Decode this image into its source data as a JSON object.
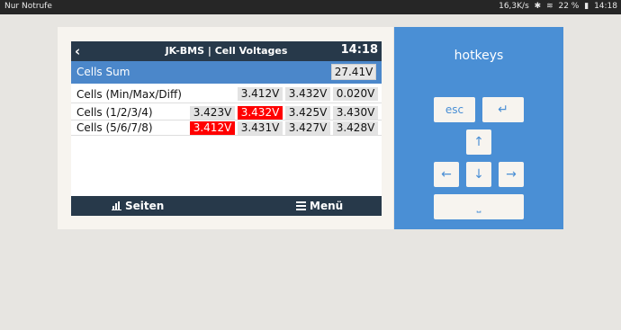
{
  "statusbar": {
    "carrier": "Nur Notrufe",
    "net_speed": "16,3K/s",
    "battery": "22 %",
    "time": "14:18"
  },
  "header": {
    "title": "JK-BMS | Cell Voltages",
    "clock": "14:18"
  },
  "sum": {
    "label": "Cells Sum",
    "value": "27.41V"
  },
  "rows": [
    {
      "label": "Cells (Min/Max/Diff)",
      "values": [
        "3.412V",
        "3.432V",
        "0.020V"
      ]
    },
    {
      "label": "Cells (1/2/3/4)",
      "values": [
        "3.423V",
        "3.432V",
        "3.425V",
        "3.430V"
      ]
    },
    {
      "label": "Cells (5/6/7/8)",
      "values": [
        "3.412V",
        "3.431V",
        "3.427V",
        "3.428V"
      ]
    }
  ],
  "footer": {
    "pages_label": "Seiten",
    "menu_label": "Menü"
  },
  "hotkeys": {
    "title": "hotkeys",
    "esc": "esc",
    "enter": "↵",
    "up": "↑",
    "left": "←",
    "down": "↓",
    "right": "→",
    "space": "⎵"
  },
  "colors": {
    "header_bg": "#27394a",
    "sum_bg": "#4b87ca",
    "alert_red": "#ff0000",
    "hotkeys_bg": "#4a8fd5"
  }
}
